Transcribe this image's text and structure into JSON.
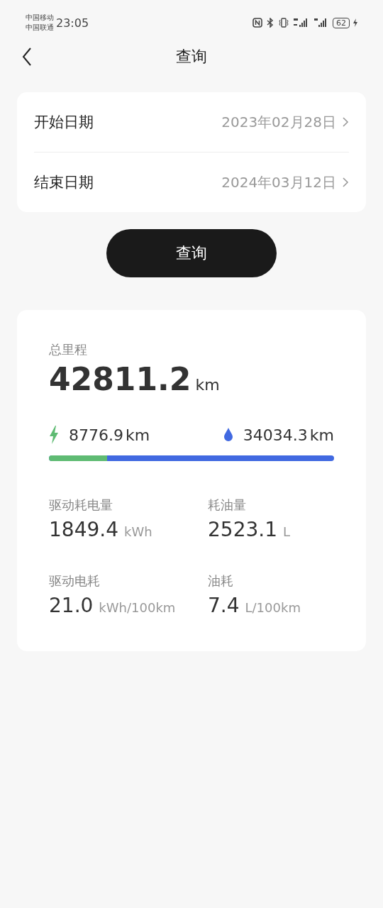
{
  "status_bar": {
    "carriers": [
      "中国移动",
      "中国联通"
    ],
    "time": "23:05",
    "battery": "62"
  },
  "nav": {
    "title": "查询"
  },
  "dates": [
    {
      "label": "开始日期",
      "value": "2023年02月28日"
    },
    {
      "label": "结束日期",
      "value": "2024年03月12日"
    }
  ],
  "query_button": "查询",
  "summary": {
    "total_label": "总里程",
    "total_value": "42811.2",
    "total_unit": "km",
    "electric": {
      "value": "8776.9",
      "unit": "km"
    },
    "fuel": {
      "value": "34034.3",
      "unit": "km"
    },
    "electric_share": {
      "level": 0.205
    },
    "stats": [
      {
        "label": "驱动耗电量",
        "value": "1849.4",
        "unit": "kWh"
      },
      {
        "label": "耗油量",
        "value": "2523.1",
        "unit": "L"
      },
      {
        "label": "驱动电耗",
        "value": "21.0",
        "unit": "kWh/100km"
      },
      {
        "label": "油耗",
        "value": "7.4",
        "unit": "L/100km"
      }
    ]
  }
}
